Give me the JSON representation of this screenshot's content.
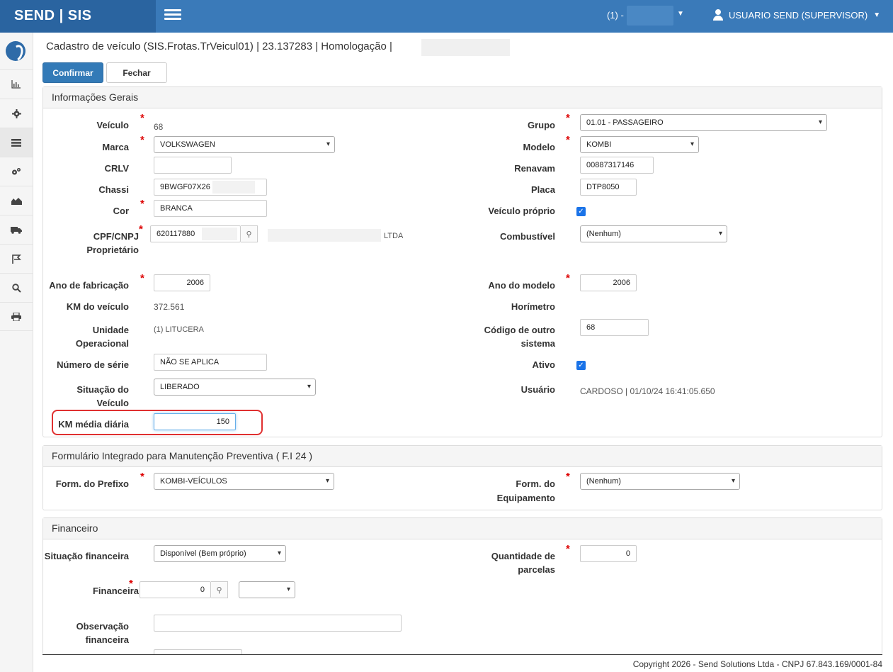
{
  "topbar": {
    "brand": "SEND | SIS",
    "unit_label": "(1) -",
    "user": "USUARIO SEND (SUPERVISOR)"
  },
  "header": {
    "title": "Cadastro de veículo (SIS.Frotas.TrVeicul01) | 23.137283 | Homologação |",
    "confirm": "Confirmar",
    "close": "Fechar"
  },
  "geral": {
    "title": "Informações Gerais",
    "veiculo_lbl": "Veículo",
    "veiculo_val": "68",
    "grupo_lbl": "Grupo",
    "grupo_val": "01.01 - PASSAGEIRO",
    "marca_lbl": "Marca",
    "marca_val": "VOLKSWAGEN",
    "modelo_lbl": "Modelo",
    "modelo_val": "KOMBI",
    "crlv_lbl": "CRLV",
    "crlv_val": "",
    "renavam_lbl": "Renavam",
    "renavam_val": "00887317146",
    "chassi_lbl": "Chassi",
    "chassi_val": "9BWGF07X26",
    "placa_lbl": "Placa",
    "placa_val": "DTP8050",
    "cor_lbl": "Cor",
    "cor_val": "BRANCA",
    "proprio_lbl": "Veículo próprio",
    "cpf_lbl1": "CPF/CNPJ",
    "cpf_lbl2": "Proprietário",
    "cpf_val": "620117880",
    "ltda": "LTDA",
    "comb_lbl": "Combustível",
    "comb_val": "(Nenhum)",
    "anofab_lbl": "Ano de fabricação",
    "anofab_val": "2006",
    "anomod_lbl": "Ano do modelo",
    "anomod_val": "2006",
    "km_lbl": "KM do veículo",
    "km_val": "372.561",
    "hor_lbl": "Horímetro",
    "unid_lbl1": "Unidade",
    "unid_lbl2": "Operacional",
    "unid_val": "(1) LITUCERA",
    "cod_lbl1": "Código de outro",
    "cod_lbl2": "sistema",
    "cod_val": "68",
    "serie_lbl": "Número de série",
    "serie_val": "NÃO SE APLICA",
    "ativo_lbl": "Ativo",
    "sit_lbl1": "Situação do",
    "sit_lbl2": "Veículo",
    "sit_val": "LIBERADO",
    "usuario_lbl": "Usuário",
    "usuario_val": "CARDOSO | 01/10/24 16:41:05.650",
    "kmmed_lbl": "KM média diária",
    "kmmed_val": "150"
  },
  "fi": {
    "title": "Formulário Integrado para Manutenção Preventiva ( F.I 24 )",
    "prefixo_lbl": "Form. do Prefixo",
    "prefixo_val": "KOMBI-VEÍCULOS",
    "equip_lbl1": "Form. do",
    "equip_lbl2": "Equipamento",
    "equip_val": "(Nenhum)"
  },
  "fin": {
    "title": "Financeiro",
    "sit_lbl": "Situação financeira",
    "sit_val": "Disponível (Bem próprio)",
    "qtd_lbl1": "Quantidade de",
    "qtd_lbl2": "parcelas",
    "qtd_val": "0",
    "finan_lbl": "Financeira",
    "finan_val": "0",
    "obs_lbl1": "Observação",
    "obs_lbl2": "financeira",
    "obs_val": ""
  },
  "footer": "Copyright 2026 - Send Solutions Ltda - CNPJ 67.843.169/0001-84"
}
